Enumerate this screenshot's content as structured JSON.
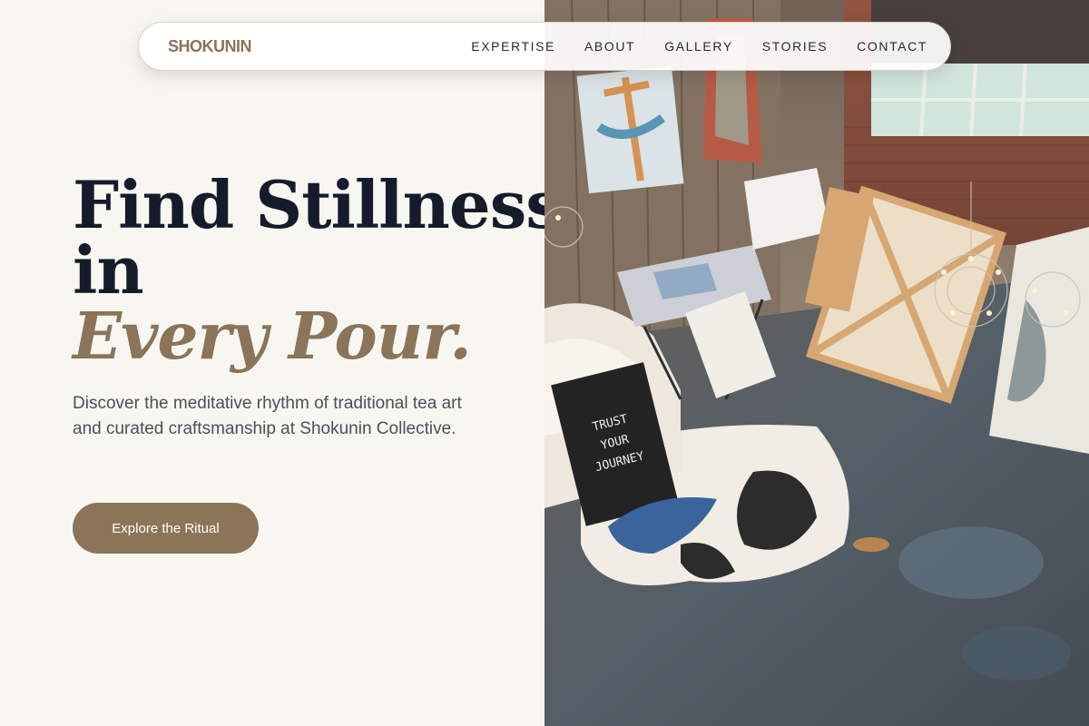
{
  "brand": {
    "name": "SHOKUNIN"
  },
  "nav": {
    "links": [
      "EXPERTISE",
      "ABOUT",
      "GALLERY",
      "STORIES",
      "CONTACT"
    ]
  },
  "hero": {
    "headline_line1": "Find Stillness",
    "headline_line2": "in",
    "headline_accent": "Every Pour.",
    "subtext": "Discover the meditative rhythm of traditional tea art and curated craftsmanship at Shokunin Collective.",
    "cta_label": "Explore the Ritual"
  },
  "image": {
    "description_icon": "studio-photo",
    "canvas_text": "TRUST YOUR JOURNEY"
  },
  "colors": {
    "background": "#f8f6f1",
    "accent": "#8b7458",
    "headline": "#151b2b",
    "body_text": "#4a4f5c"
  }
}
